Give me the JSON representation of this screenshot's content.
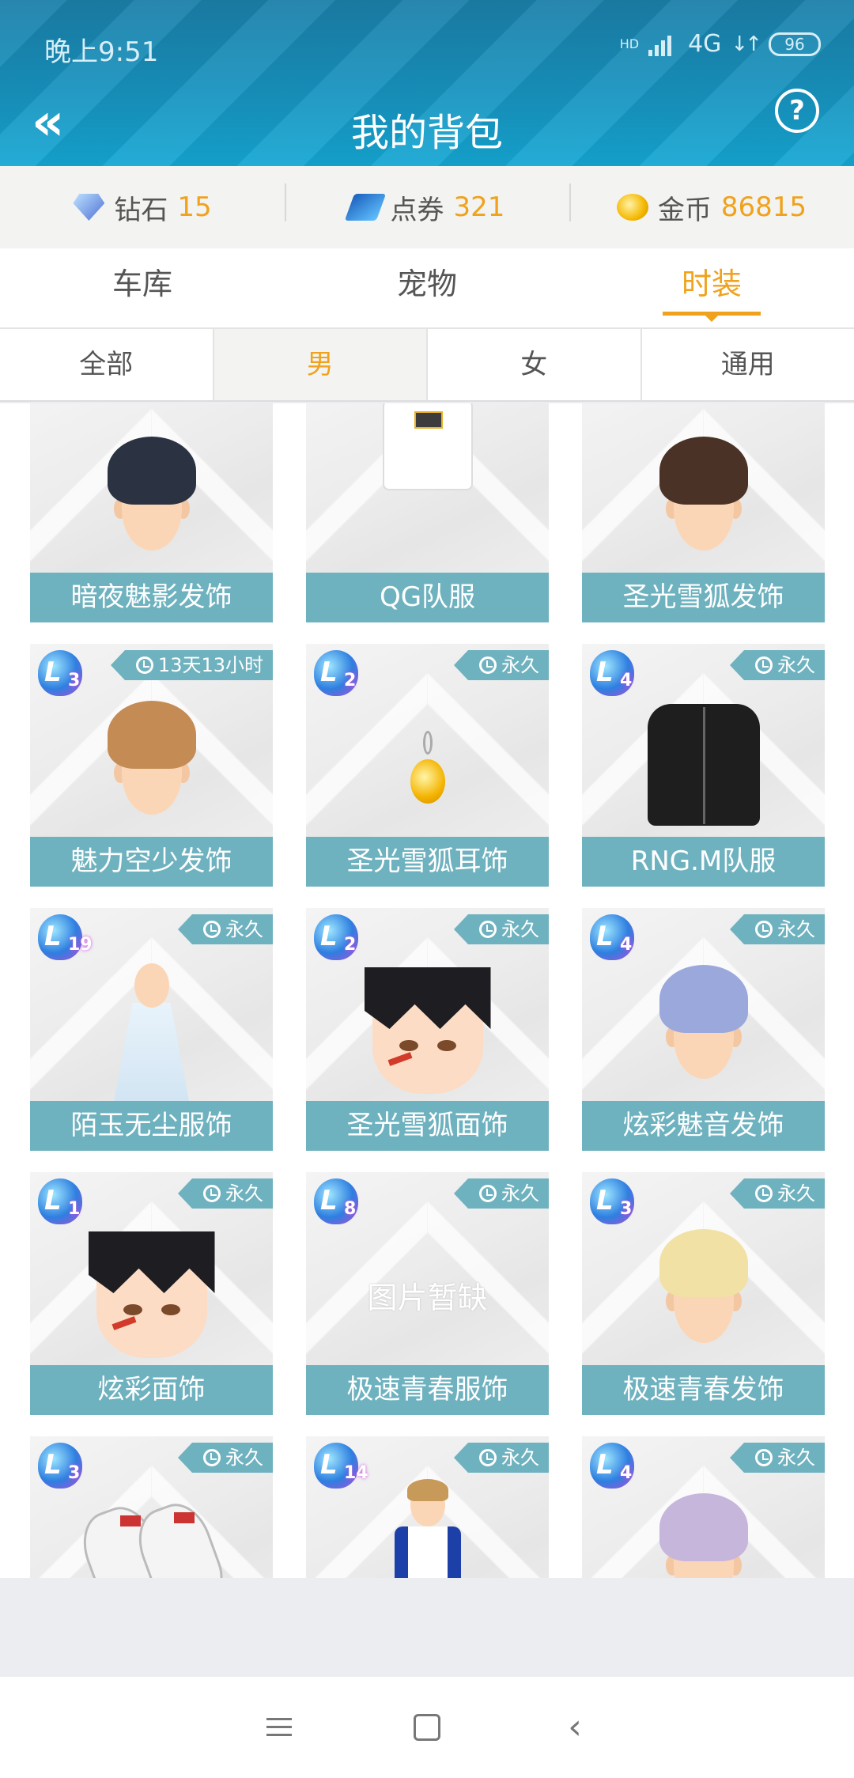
{
  "status_bar": {
    "time": "晚上9:51",
    "network": "4G",
    "hd": "HD",
    "battery": "96"
  },
  "header": {
    "back": "«",
    "title": "我的背包",
    "help": "?"
  },
  "currencies": [
    {
      "icon": "diamond-icon",
      "label": "钻石",
      "value": "15"
    },
    {
      "icon": "ticket-icon",
      "label": "点券",
      "value": "321"
    },
    {
      "icon": "coin-icon",
      "label": "金币",
      "value": "86815"
    }
  ],
  "main_tabs": [
    "车库",
    "宠物",
    "时装"
  ],
  "main_tab_active": "时装",
  "sub_tabs": [
    "全部",
    "男",
    "女",
    "通用"
  ],
  "sub_tab_active": "男",
  "items": [
    {
      "name": "暗夜魅影发饰",
      "art": "hair",
      "hair_color": "#2b3242"
    },
    {
      "name": "QG队服",
      "art": "hoodie"
    },
    {
      "name": "圣光雪狐发饰",
      "art": "hair",
      "hair_color": "#4a3326"
    },
    {
      "name": "魅力空少发饰",
      "art": "hair",
      "hair_color": "#c48b55",
      "level": "3",
      "duration": "13天13小时"
    },
    {
      "name": "圣光雪狐耳饰",
      "art": "earring",
      "level": "2",
      "duration": "永久"
    },
    {
      "name": "RNG.M队服",
      "art": "jacket",
      "level": "4",
      "duration": "永久"
    },
    {
      "name": "陌玉无尘服饰",
      "art": "robe",
      "level": "19",
      "duration": "永久"
    },
    {
      "name": "圣光雪狐面饰",
      "art": "face",
      "level": "2",
      "duration": "永久"
    },
    {
      "name": "炫彩魅音发饰",
      "art": "hair",
      "hair_color": "#9aa8dc",
      "level": "4",
      "duration": "永久"
    },
    {
      "name": "炫彩面饰",
      "art": "face",
      "level": "1",
      "duration": "永久"
    },
    {
      "name": "极速青春服饰",
      "art": "none",
      "placeholder": "图片暂缺",
      "level": "8",
      "duration": "永久"
    },
    {
      "name": "极速青春发饰",
      "art": "hair",
      "hair_color": "#f1e1a4",
      "level": "3",
      "duration": "永久"
    },
    {
      "name": "",
      "art": "shoes",
      "level": "3",
      "duration": "永久"
    },
    {
      "name": "",
      "art": "racer",
      "level": "14",
      "duration": "永久"
    },
    {
      "name": "",
      "art": "hair",
      "hair_color": "#c7b6dc",
      "level": "4",
      "duration": "永久"
    }
  ],
  "nav_bar": [
    "menu-icon",
    "home-icon",
    "back-icon"
  ]
}
